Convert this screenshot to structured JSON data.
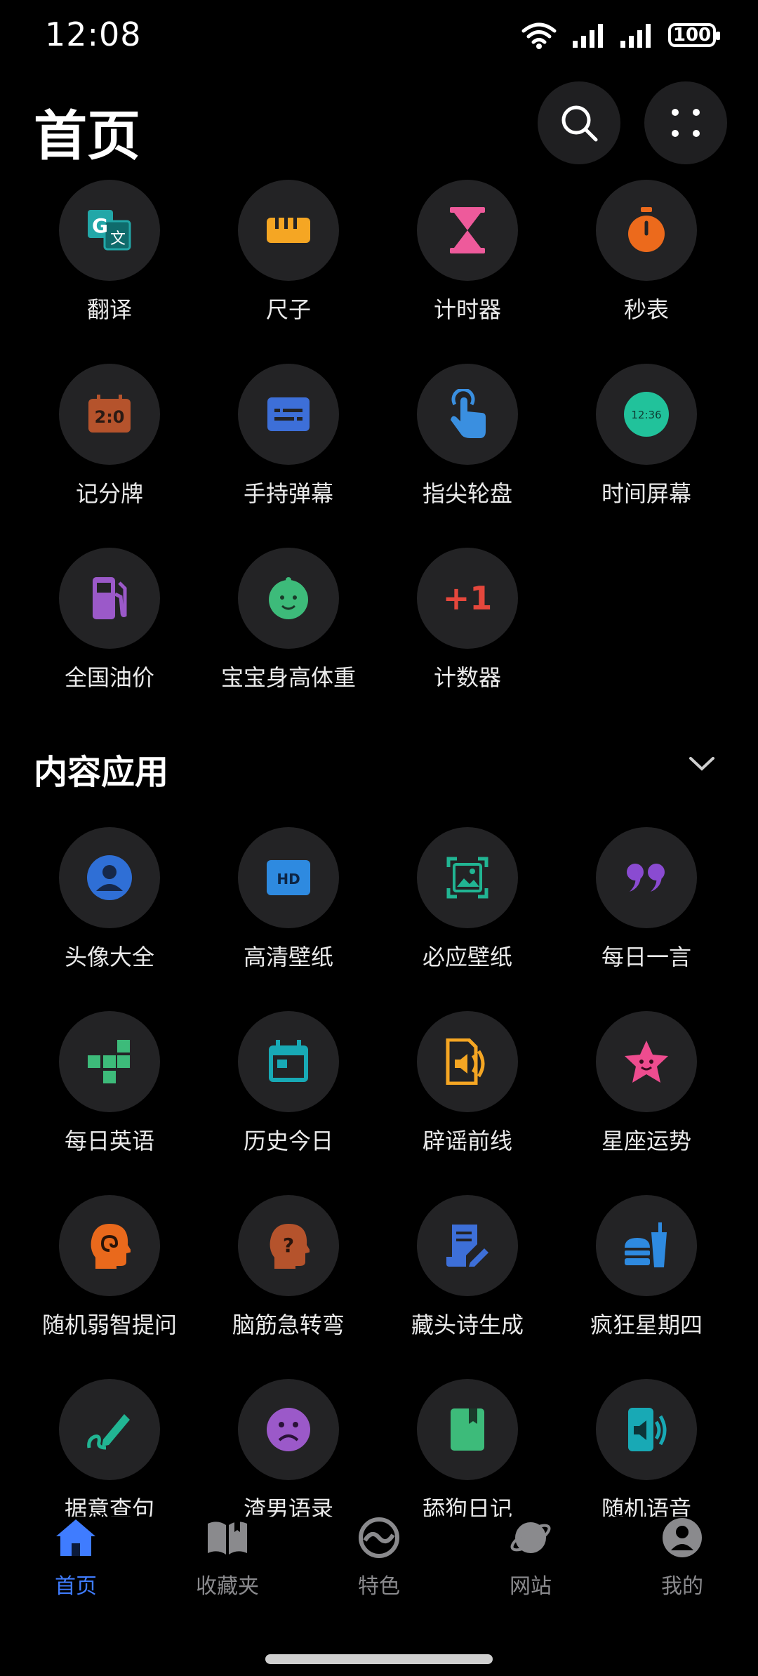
{
  "status_bar": {
    "time": "12:08",
    "battery": "100"
  },
  "header": {
    "title": "首页"
  },
  "tools": [
    {
      "label": "翻译",
      "icon": "translate-icon"
    },
    {
      "label": "尺子",
      "icon": "ruler-icon"
    },
    {
      "label": "计时器",
      "icon": "hourglass-icon"
    },
    {
      "label": "秒表",
      "icon": "stopwatch-icon"
    },
    {
      "label": "记分牌",
      "icon": "scoreboard-icon"
    },
    {
      "label": "手持弹幕",
      "icon": "danmaku-icon"
    },
    {
      "label": "指尖轮盘",
      "icon": "finger-tap-icon"
    },
    {
      "label": "时间屏幕",
      "icon": "clock-screen-icon"
    },
    {
      "label": "全国油价",
      "icon": "fuel-pump-icon"
    },
    {
      "label": "宝宝身高体重",
      "icon": "baby-face-icon"
    },
    {
      "label": "计数器",
      "icon": "plus-one-icon"
    }
  ],
  "clock_icon_text": "12:36",
  "hd_icon_text": "HD",
  "score_icon_text": "2:0",
  "counter_icon_text": "+1",
  "content_section": {
    "title": "内容应用"
  },
  "content_apps": [
    {
      "label": "头像大全",
      "icon": "avatar-icon"
    },
    {
      "label": "高清壁纸",
      "icon": "hd-wallpaper-icon"
    },
    {
      "label": "必应壁纸",
      "icon": "image-frame-icon"
    },
    {
      "label": "每日一言",
      "icon": "quote-icon"
    },
    {
      "label": "每日英语",
      "icon": "blocks-icon"
    },
    {
      "label": "历史今日",
      "icon": "calendar-icon"
    },
    {
      "label": "辟谣前线",
      "icon": "speaker-doc-icon"
    },
    {
      "label": "星座运势",
      "icon": "star-face-icon"
    },
    {
      "label": "随机弱智提问",
      "icon": "swirl-head-icon"
    },
    {
      "label": "脑筋急转弯",
      "icon": "question-head-icon"
    },
    {
      "label": "藏头诗生成",
      "icon": "poem-edit-icon"
    },
    {
      "label": "疯狂星期四",
      "icon": "burger-drink-icon"
    },
    {
      "label": "据意查句",
      "icon": "pen-scribble-icon"
    },
    {
      "label": "渣男语录",
      "icon": "sad-face-icon"
    },
    {
      "label": "舔狗日记",
      "icon": "diary-book-icon"
    },
    {
      "label": "随机语音",
      "icon": "phone-sound-icon"
    }
  ],
  "bottom_nav": [
    {
      "label": "首页",
      "icon": "home-icon",
      "active": true
    },
    {
      "label": "收藏夹",
      "icon": "book-open-icon",
      "active": false
    },
    {
      "label": "特色",
      "icon": "feature-icon",
      "active": false
    },
    {
      "label": "网站",
      "icon": "planet-icon",
      "active": false
    },
    {
      "label": "我的",
      "icon": "profile-icon",
      "active": false
    }
  ],
  "colors": {
    "accent": "#3f7cff",
    "tile_bg": "#232325",
    "background": "#000000"
  }
}
